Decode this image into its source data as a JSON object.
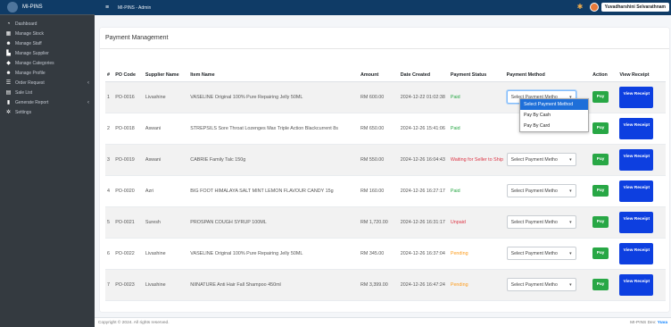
{
  "brand": {
    "name": "MI-PINS"
  },
  "topbar": {
    "title": "MI-PINS - Admin",
    "user_name": "Yuvadharshini Selvarathnam"
  },
  "sidebar": {
    "items": [
      {
        "label": "Dashboard",
        "icon": "dashboard-icon"
      },
      {
        "label": "Manage Stock",
        "icon": "boxes-icon"
      },
      {
        "label": "Manage Staff",
        "icon": "users-icon"
      },
      {
        "label": "Manage Supplier",
        "icon": "truck-icon"
      },
      {
        "label": "Manage Categories",
        "icon": "tags-icon"
      },
      {
        "label": "Manage Profile",
        "icon": "user-icon"
      },
      {
        "label": "Order Request",
        "icon": "list-icon",
        "caret": "‹"
      },
      {
        "label": "Sale List",
        "icon": "cart-icon"
      },
      {
        "label": "Generate Report",
        "icon": "file-icon",
        "caret": "‹"
      },
      {
        "label": "Settings",
        "icon": "gears-icon"
      }
    ]
  },
  "page": {
    "title": "Payment Management"
  },
  "table": {
    "headers": {
      "no": "#",
      "po": "PO Code",
      "supplier": "Supplier Name",
      "item": "Item Name",
      "amount": "Amount",
      "date": "Date Created",
      "status": "Payment Status",
      "method": "Payment Method",
      "action": "Action",
      "view": "View Receipt"
    },
    "rows": [
      {
        "no": "1",
        "po": "PO-0016",
        "supplier": "Livashine",
        "item": "VASELINE Original 100% Pure Repairing Jelly 50ML",
        "amount": "RM 600.00",
        "date": "2024-12-22 01:02:38",
        "status": "Paid",
        "status_class": "st-paid",
        "method": "Select Payment Metho",
        "action": "Pay",
        "view": "View Receipt"
      },
      {
        "no": "2",
        "po": "PO-0018",
        "supplier": "Aswani",
        "item": "STREPSILS Sore Throat Lozenges Max Triple Action Blackcurrent 8s",
        "amount": "RM 650.00",
        "date": "2024-12-26 15:41:06",
        "status": "Paid",
        "status_class": "st-paid",
        "method": "",
        "action": "Pay",
        "view": "View Receipt"
      },
      {
        "no": "3",
        "po": "PO-0019",
        "supplier": "Aswani",
        "item": "CABRIE Family Talc 150g",
        "amount": "RM 550.00",
        "date": "2024-12-26 16:04:43",
        "status": "Waiting for Seller to Ship",
        "status_class": "st-wait",
        "method": "Select Payment Metho",
        "action": "Pay",
        "view": "View Receipt"
      },
      {
        "no": "4",
        "po": "PO-0020",
        "supplier": "Azri",
        "item": "BIG FOOT HIMALAYA SALT MINT LEMON FLAVOUR CANDY 15g",
        "amount": "RM 160.00",
        "date": "2024-12-26 16:27:17",
        "status": "Paid",
        "status_class": "st-paid",
        "method": "Select Payment Metho",
        "action": "Pay",
        "view": "View Receipt"
      },
      {
        "no": "5",
        "po": "PO-0021",
        "supplier": "Suresh",
        "item": "PROSPAN COUGH SYRUP 100ML",
        "amount": "RM 1,720.00",
        "date": "2024-12-26 16:31:17",
        "status": "Unpaid",
        "status_class": "st-unpaid",
        "method": "Select Payment Metho",
        "action": "Pay",
        "view": "View Receipt"
      },
      {
        "no": "6",
        "po": "PO-0022",
        "supplier": "Livashine",
        "item": "VASELINE Original 100% Pure Repairing Jelly 50ML",
        "amount": "RM 345.00",
        "date": "2024-12-26 16:37:04",
        "status": "Pending",
        "status_class": "st-pending",
        "method": "Select Payment Metho",
        "action": "Pay",
        "view": "View Receipt"
      },
      {
        "no": "7",
        "po": "PO-0023",
        "supplier": "Livashine",
        "item": "NIINATURE Anti Hair Fall Shampoo 450ml",
        "amount": "RM 3,399.00",
        "date": "2024-12-26 16:47:24",
        "status": "Pending",
        "status_class": "st-pending",
        "method": "Select Payment Metho",
        "action": "Pay",
        "view": "View Receipt"
      }
    ]
  },
  "dropdown": {
    "options": [
      "Select Payment Method",
      "Pay By Cash",
      "Pay By Card"
    ]
  },
  "footer": {
    "copyright": "Copyright © 2024. All rights reserved.",
    "right_text": "MI-PINS Dev:",
    "right_link": "Yuva"
  },
  "colors": {
    "sidebar": "#343a40",
    "topbar": "#0f3b66",
    "paid": "#28a745",
    "unpaid": "#dc3545",
    "pending": "#fd9c1c",
    "view_button": "#0d3fe0"
  }
}
